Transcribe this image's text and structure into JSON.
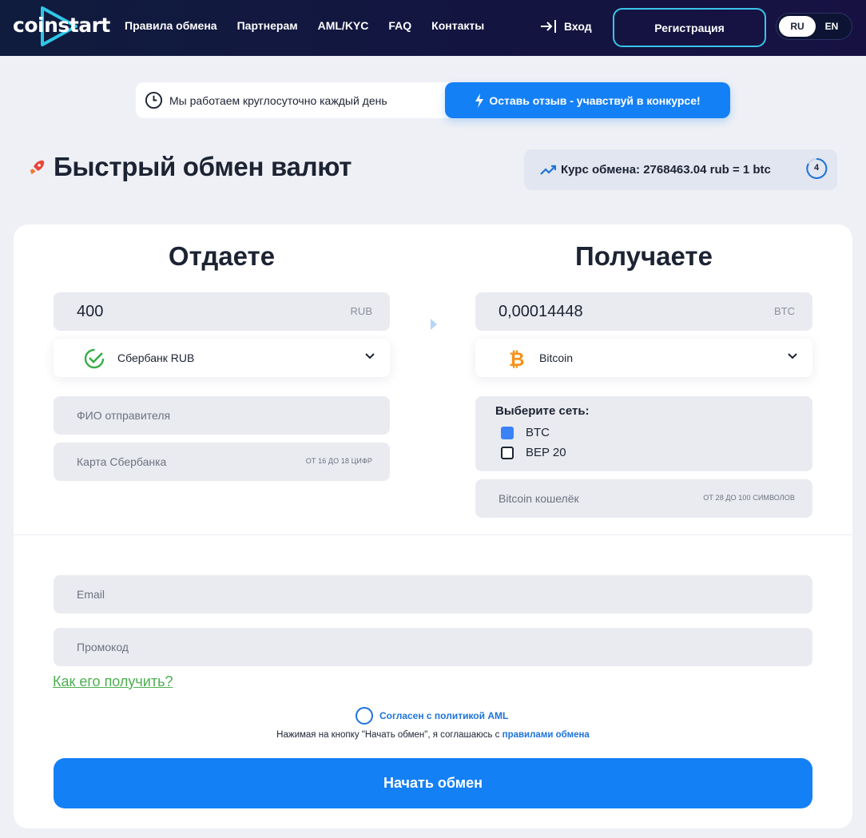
{
  "header": {
    "logo_text": "coinstart",
    "nav": [
      "Правила обмена",
      "Партнерам",
      "AML/KYC",
      "FAQ",
      "Контакты"
    ],
    "login_label": "Вход",
    "register_label": "Регистрация",
    "lang": {
      "ru": "RU",
      "en": "EN"
    }
  },
  "banner": {
    "info": "Мы работаем круглосуточно каждый день",
    "review_button": "Оставь отзыв - учавствуй в конкурсе!"
  },
  "page_title": "Быстрый обмен валют",
  "rate": {
    "text": "Курс обмена: 2768463.04 rub = 1 btc",
    "timer": "4"
  },
  "give": {
    "title": "Отдаете",
    "amount": "400",
    "currency": "RUB",
    "method": "Сбербанк RUB",
    "name_placeholder": "ФИО отправителя",
    "card_placeholder": "Карта Сбербанка",
    "card_hint": "ОТ 16 ДО 18 ЦИФР"
  },
  "get": {
    "title": "Получаете",
    "amount": "0,00014448",
    "currency": "BTC",
    "method": "Bitcoin",
    "network_title": "Выберите сеть:",
    "networks": [
      {
        "label": "BTC",
        "checked": true
      },
      {
        "label": "BEP 20",
        "checked": false
      }
    ],
    "wallet_placeholder": "Bitcoin кошелёк",
    "wallet_hint": "ОТ 28 ДО 100 СИМВОЛОВ"
  },
  "contact": {
    "email_placeholder": "Email",
    "promo_placeholder": "Промокод",
    "promo_link": "Как его получить?"
  },
  "aml_label": "Согласен с политикой AML",
  "agree_text": "Нажимая на кнопку \"Начать обмен\", я соглашаюсь с ",
  "agree_link": "правилами обмена",
  "start_button": "Начать обмен",
  "colors": {
    "accent": "#1480f5",
    "header_bg": "#131540",
    "link_green": "#4caf50",
    "checkbox_on": "#3b82f6"
  },
  "icons": {
    "clock": "clock-icon",
    "bolt": "lightning-icon",
    "rocket": "rocket-icon",
    "trend": "trend-up-icon",
    "sber": "sberbank-logo-icon",
    "btc": "bitcoin-icon",
    "login": "login-arrow-icon"
  }
}
